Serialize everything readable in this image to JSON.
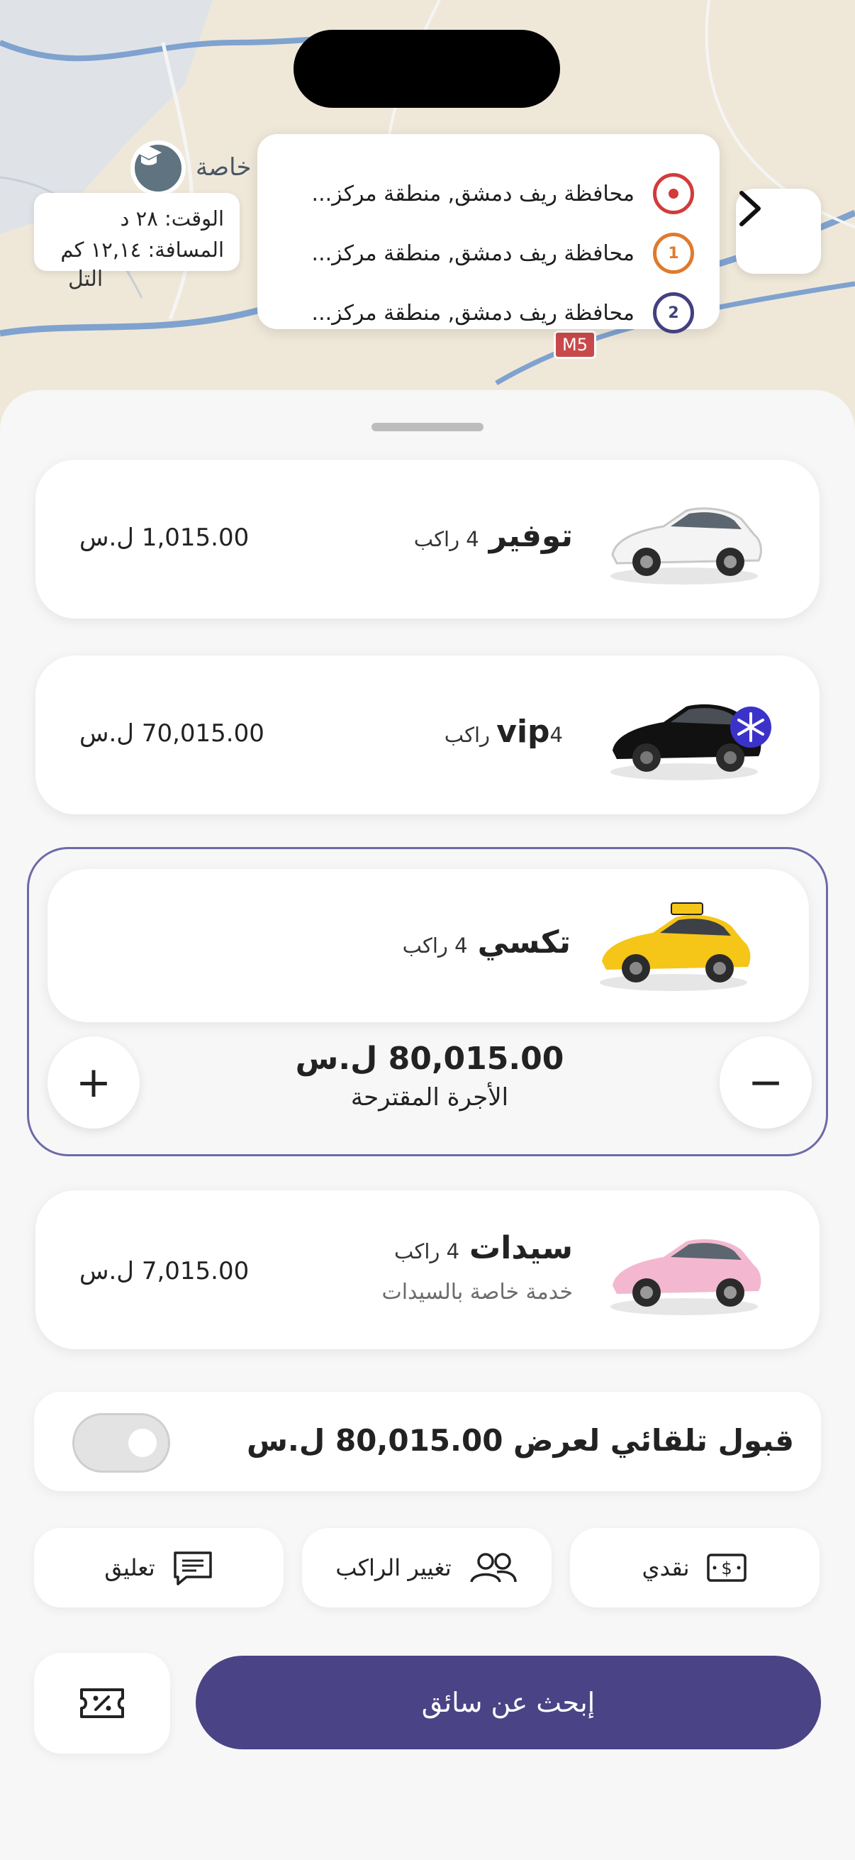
{
  "map": {
    "route": {
      "stops": [
        {
          "marker": "origin",
          "text": "محافظة ريف دمشق, منطقة مركز..."
        },
        {
          "marker": "1",
          "text": "محافظة ريف دمشق, منطقة مركز..."
        },
        {
          "marker": "2",
          "text": "محافظة ريف دمشق, منطقة مركز..."
        }
      ]
    },
    "trip_info": {
      "time": "الوقت: ٢٨ د",
      "distance": "المسافة: ١٢,١٤ كم"
    },
    "labels": {
      "school": "خاصة",
      "area": "التل",
      "highway": "M5"
    }
  },
  "rides": [
    {
      "name": "توفير",
      "passengers": "4 راكب",
      "price": "1,015.00 ل.س",
      "color": "#f4f4f4"
    },
    {
      "name": "vip",
      "passengers": "4 راكب",
      "price": "70,015.00 ل.س",
      "color": "#111111"
    },
    {
      "name": "تكسي",
      "passengers": "4 راكب",
      "color": "#f5c518"
    },
    {
      "name": "سيدات",
      "passengers": "4 راكب",
      "subtitle": "خدمة خاصة بالسيدات",
      "price": "7,015.00 ل.س",
      "color": "#f3b8cf"
    }
  ],
  "selected_fare": {
    "amount": "80,015.00 ل.س",
    "label": "الأجرة المقترحة",
    "minus": "−",
    "plus": "+"
  },
  "auto_accept": {
    "label": "قبول تلقائي لعرض 80,015.00 ل.س",
    "enabled": false
  },
  "options": {
    "payment": "نقدي",
    "change_passenger": "تغيير الراكب",
    "comment": "تعليق"
  },
  "search_button": "إبحث عن سائق",
  "colors": {
    "primary": "#4a4385",
    "origin_marker": "#d23b3b",
    "stop1_marker": "#e07a2c",
    "stop2_marker": "#43407f"
  }
}
